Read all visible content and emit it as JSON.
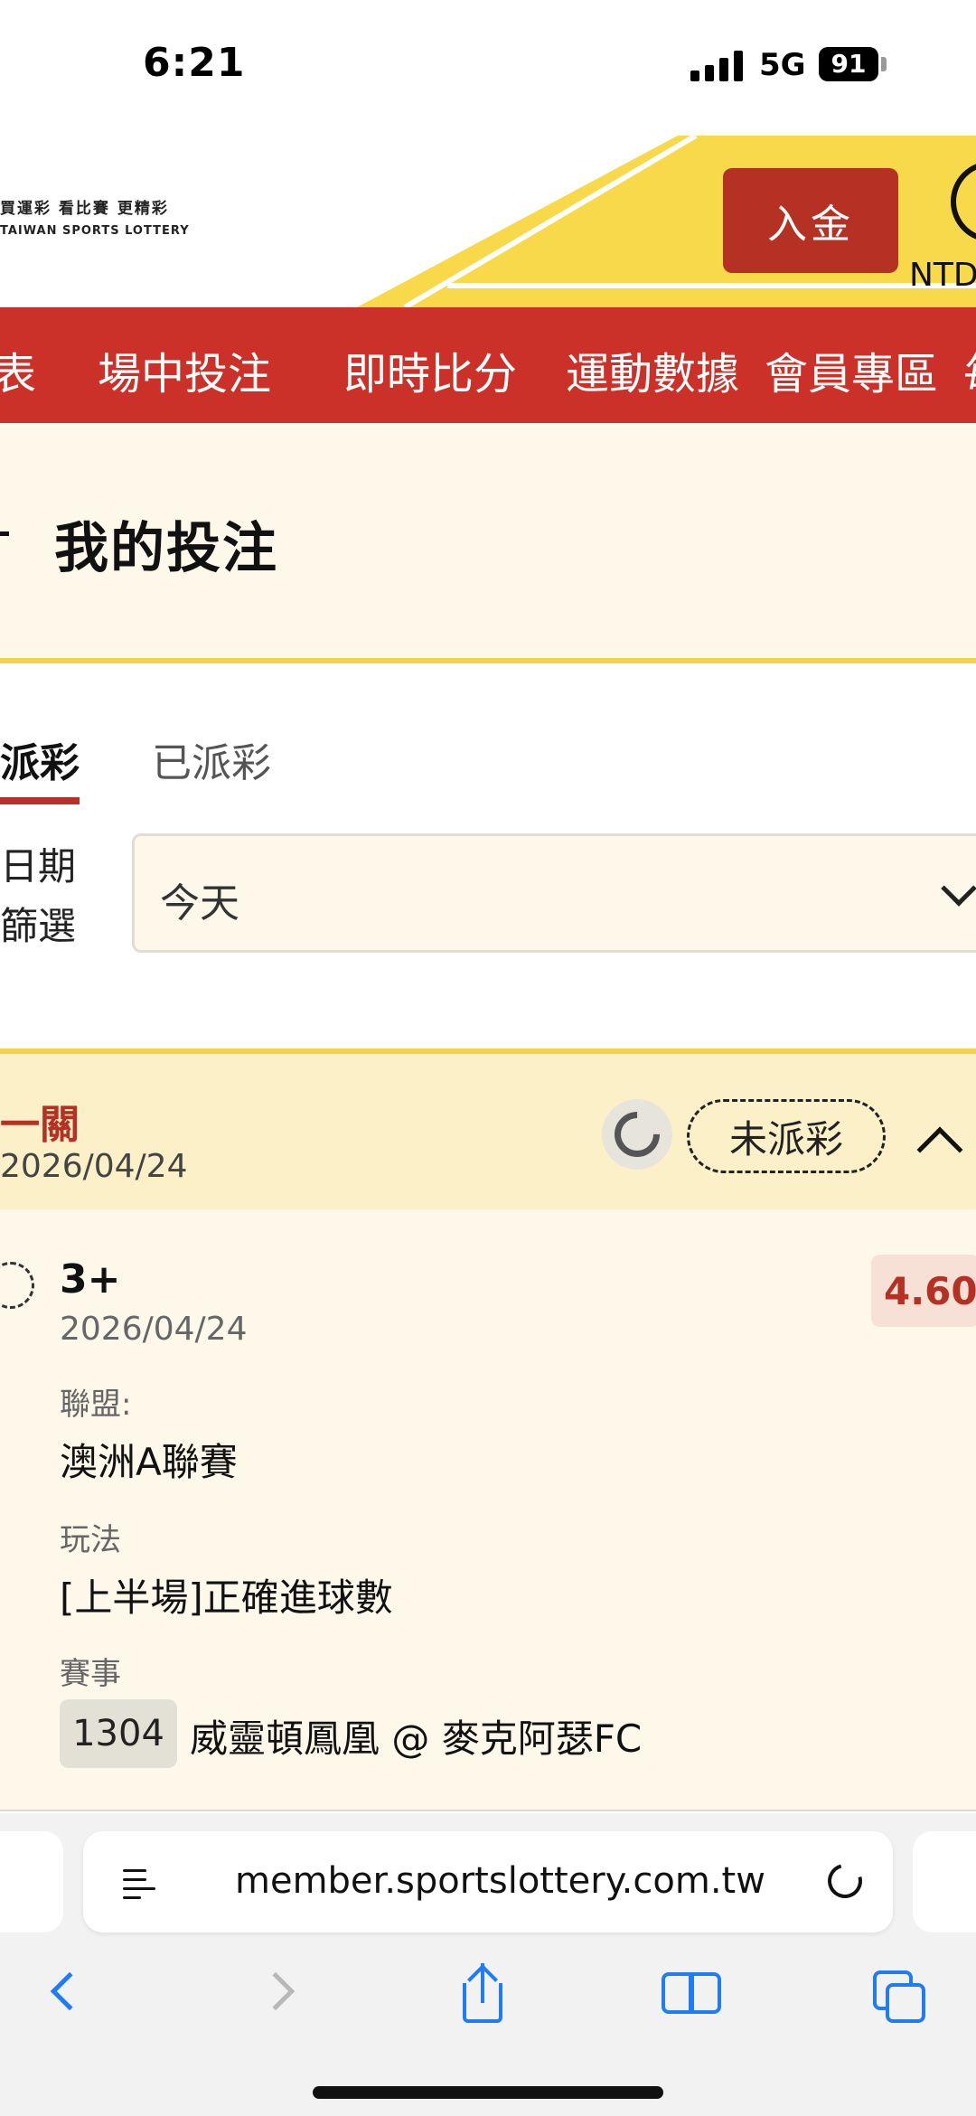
{
  "status_bar": {
    "time": "6:21",
    "network": "5G",
    "battery": "91"
  },
  "header": {
    "logo_slogan": "買運彩 看比賽 更精彩",
    "logo_english": "TAIWAN SPORTS LOTTERY",
    "deposit_button": "入金",
    "currency_label": "NTD",
    "accent_color": "#f7d94a",
    "brand_red": "#cb3128"
  },
  "nav": {
    "items": [
      {
        "label": "表"
      },
      {
        "label": "場中投注"
      },
      {
        "label": "即時比分"
      },
      {
        "label": "運動數據"
      },
      {
        "label": "會員專區"
      },
      {
        "label": "毎"
      }
    ]
  },
  "page": {
    "title": "我的投注"
  },
  "tabs": [
    {
      "label": "派彩",
      "active": true
    },
    {
      "label": "已派彩",
      "active": false
    }
  ],
  "filter": {
    "label_line1": "日期",
    "label_line2": "篩選",
    "selected": "今天"
  },
  "bet": {
    "type": "一關",
    "date": "2026/04/24",
    "status": "未派彩",
    "pick": "3+",
    "pick_date": "2026/04/24",
    "odds": "4.60",
    "league_label": "聯盟:",
    "league": "澳洲A聯賽",
    "market_label": "玩法",
    "market": "[上半場]正確進球數",
    "match_label": "賽事",
    "match_id": "1304",
    "match": "威靈頓鳳凰 @ 麥克阿瑟FC"
  },
  "browser": {
    "url": "member.sportslottery.com.tw"
  }
}
